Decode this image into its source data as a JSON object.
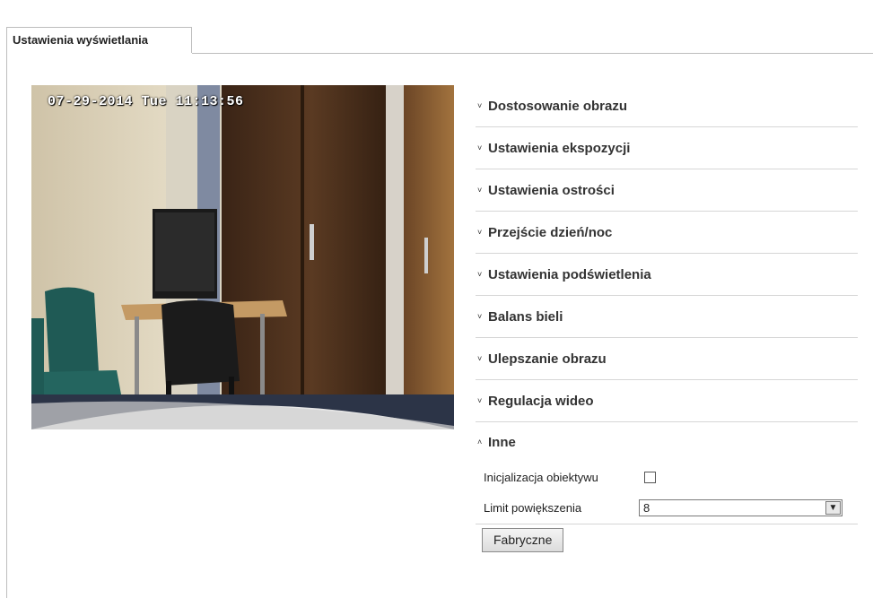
{
  "tab": {
    "label": "Ustawienia wyświetlania"
  },
  "video": {
    "osd_text": "07-29-2014 Tue 11:13:56"
  },
  "sections": [
    {
      "label": "Dostosowanie obrazu",
      "chevron": "˅"
    },
    {
      "label": "Ustawienia ekspozycji",
      "chevron": "˅"
    },
    {
      "label": "Ustawienia ostrości",
      "chevron": "˅"
    },
    {
      "label": "Przejście dzień/noc",
      "chevron": "˅"
    },
    {
      "label": "Ustawienia podświetlenia",
      "chevron": "˅"
    },
    {
      "label": "Balans bieli",
      "chevron": "˅"
    },
    {
      "label": "Ulepszanie obrazu",
      "chevron": "˅"
    },
    {
      "label": "Regulacja wideo",
      "chevron": "˅"
    },
    {
      "label": "Inne",
      "chevron": "˄"
    }
  ],
  "inne": {
    "lens_init_label": "Inicjalizacja obiektywu",
    "lens_init_checked": false,
    "zoom_limit_label": "Limit powiększenia",
    "zoom_limit_value": "8",
    "default_button": "Fabryczne"
  }
}
